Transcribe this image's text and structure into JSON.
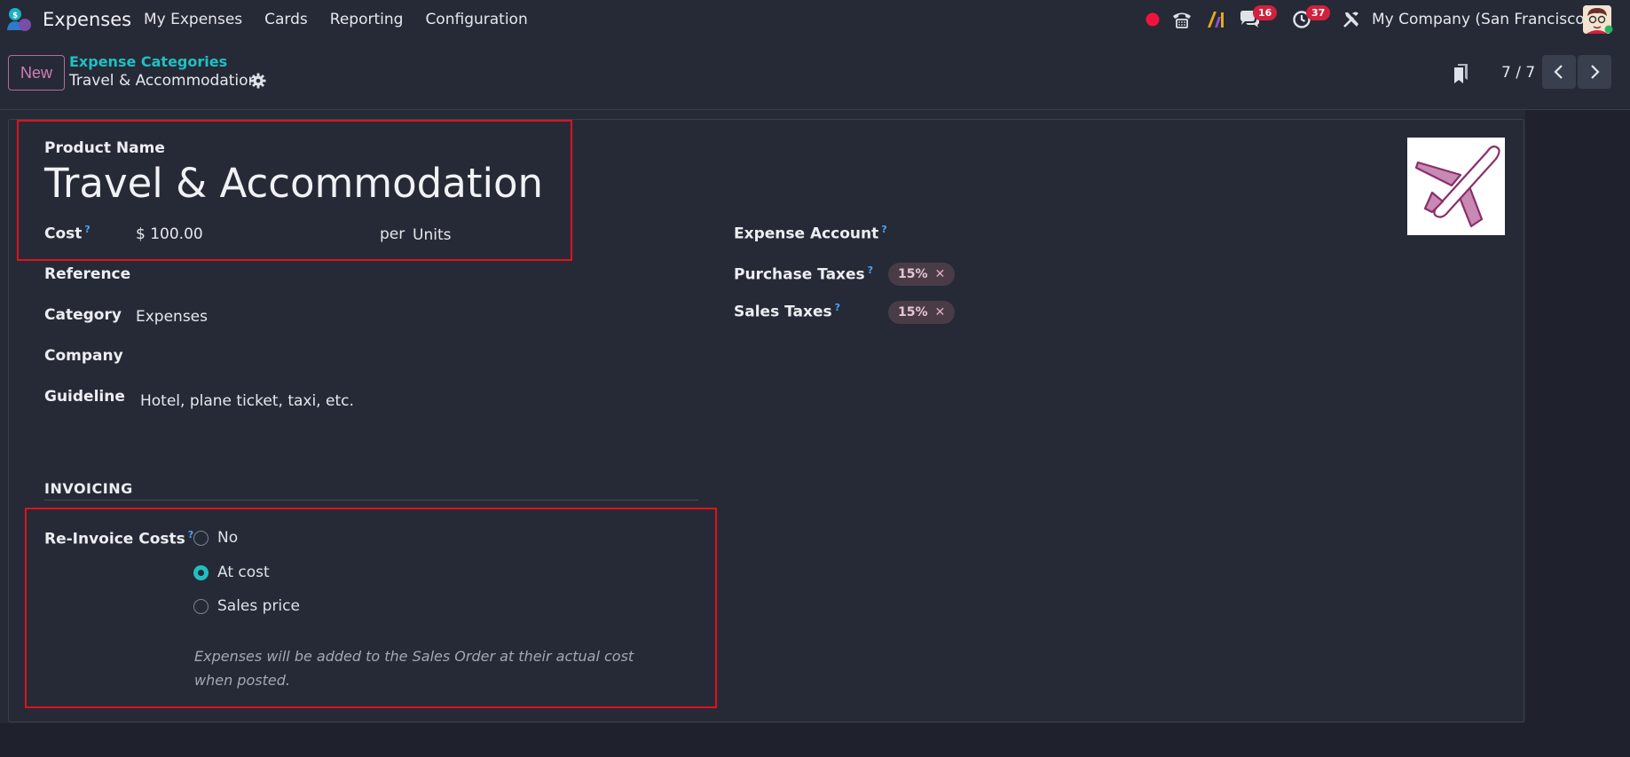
{
  "navbar": {
    "app_title": "Expenses",
    "menu": [
      "My Expenses",
      "Cards",
      "Reporting",
      "Configuration"
    ],
    "messages_count": "16",
    "activities_count": "37",
    "company": "My Company (San Francisco)"
  },
  "control": {
    "new_label": "New",
    "breadcrumb_parent": "Expense Categories",
    "breadcrumb_current": "Travel & Accommodation",
    "pager": "7 / 7"
  },
  "form": {
    "product_name_label": "Product Name",
    "product_name": "Travel & Accommodation",
    "cost_label": "Cost",
    "cost_value": "$ 100.00",
    "per_label": "per",
    "uom": "Units",
    "reference_label": "Reference",
    "category_label": "Category",
    "category_value": "Expenses",
    "company_label": "Company",
    "guideline_label": "Guideline",
    "guideline_value": "Hotel, plane ticket, taxi, etc.",
    "expense_account_label": "Expense Account",
    "purchase_taxes_label": "Purchase Taxes",
    "purchase_tax_tag": "15%",
    "sales_taxes_label": "Sales Taxes",
    "sales_tax_tag": "15%",
    "help_mark": "?",
    "tag_remove": "✕"
  },
  "invoicing": {
    "section_title": "INVOICING",
    "reinvoice_label": "Re-Invoice Costs",
    "options": [
      "No",
      "At cost",
      "Sales price"
    ],
    "selected": "At cost",
    "help_text": "Expenses will be added to the Sales Order at their actual cost when posted."
  },
  "colors": {
    "accent_teal": "#1fc0c2",
    "primary_pink": "#b46c9b",
    "highlight_red": "#e0121a",
    "badge_red": "#d0223d"
  },
  "icons": [
    "app-icon",
    "record-dot-icon",
    "phone-icon",
    "ai-icon",
    "chat-icon",
    "clock-icon",
    "tools-icon",
    "gear-icon",
    "document-icon",
    "chevron-left-icon",
    "chevron-right-icon",
    "airplane-icon"
  ]
}
